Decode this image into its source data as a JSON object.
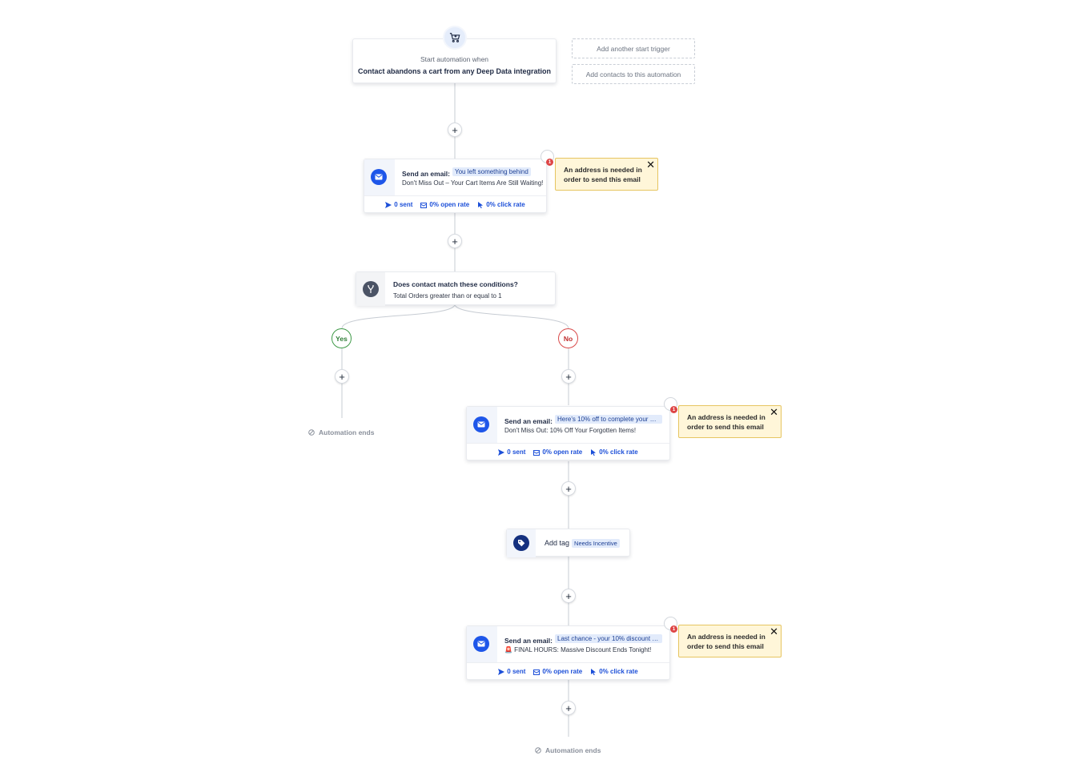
{
  "trigger": {
    "sub": "Start automation when",
    "main": "Contact abandons a cart from any Deep Data integration",
    "icon": "cart-icon"
  },
  "side_buttons": {
    "add_trigger": "Add another start trigger",
    "add_contacts": "Add contacts to this automation"
  },
  "plus_symbol": "+",
  "emails": [
    {
      "title": "Send an email:",
      "subject": "You left something behind",
      "preview": "Don't Miss Out – Your Cart Items Are Still Waiting!",
      "stats": {
        "sent": "0 sent",
        "open": "0% open rate",
        "click": "0% click rate"
      }
    },
    {
      "title": "Send an email:",
      "subject": "Here's 10% off to complete your or...",
      "preview": "Don't Miss Out: 10% Off Your Forgotten Items!",
      "stats": {
        "sent": "0 sent",
        "open": "0% open rate",
        "click": "0% click rate"
      }
    },
    {
      "title": "Send an email:",
      "subject": "Last chance - your 10% discount e...",
      "preview": "🚨 FINAL HOURS: Massive Discount Ends Tonight!",
      "stats": {
        "sent": "0 sent",
        "open": "0% open rate",
        "click": "0% click rate"
      }
    }
  ],
  "warning": {
    "count": "1",
    "text": "An address is needed in order to send this email",
    "close": "✕"
  },
  "condition": {
    "title": "Does contact match these conditions?",
    "sub": "Total Orders greater than or equal to 1"
  },
  "branches": {
    "yes": "Yes",
    "no": "No"
  },
  "tag": {
    "label": "Add tag",
    "chip": "Needs Incentive"
  },
  "automation_ends": "Automation ends",
  "colors": {
    "accent": "#1e56e9",
    "tag_icon": "#14307f",
    "warning_bg": "#fff6d9",
    "warning_border": "#e6c561",
    "yes": "#3f9a48",
    "no": "#d94a4a"
  }
}
